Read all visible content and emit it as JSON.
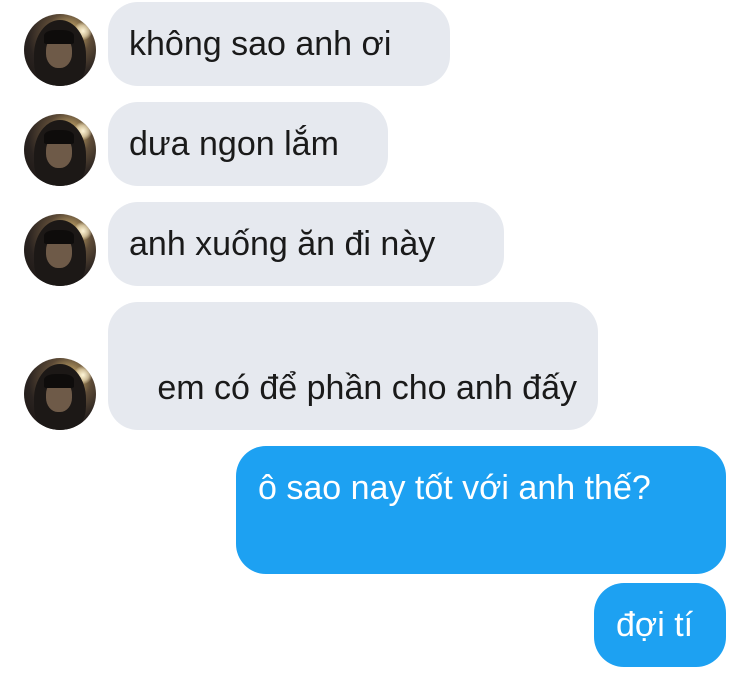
{
  "messages": [
    {
      "side": "incoming",
      "text": "không sao anh ơi"
    },
    {
      "side": "incoming",
      "text": "dưa ngon lắm"
    },
    {
      "side": "incoming",
      "text": "anh xuống ăn đi này"
    },
    {
      "side": "incoming",
      "text": " em có để phần cho anh đấy"
    },
    {
      "side": "outgoing",
      "text": "ô sao nay tốt với anh thế?"
    },
    {
      "side": "outgoing",
      "text": "đợi tí"
    }
  ],
  "colors": {
    "incoming_bubble": "#e6e9ef",
    "outgoing_bubble": "#1da1f2",
    "incoming_text": "#1a1a1a",
    "outgoing_text": "#ffffff"
  }
}
